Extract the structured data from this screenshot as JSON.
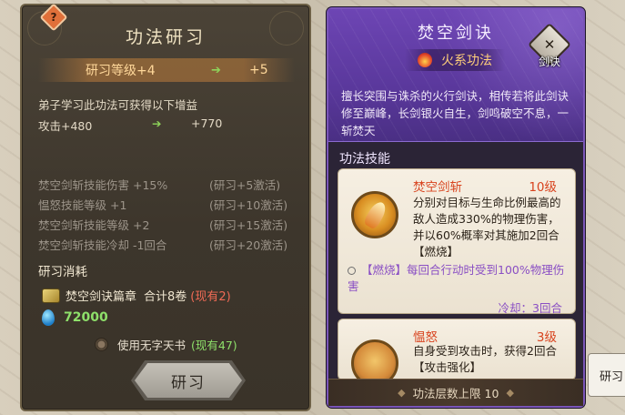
{
  "left_panel": {
    "help_badge": "?",
    "title": "功法研习",
    "level": {
      "label": "研习等级+4",
      "next": "+5"
    },
    "gain_desc": "弟子学习此功法可获得以下增益",
    "attack": {
      "current": "攻击+480",
      "next": "+770"
    },
    "bonuses": [
      {
        "name": "焚空剑斩技能伤害 +15%",
        "req": "(研习+5激活)"
      },
      {
        "name": "愠怒技能等级 +1",
        "req": "(研习+10激活)"
      },
      {
        "name": "焚空剑斩技能等级 +2",
        "req": "(研习+15激活)"
      },
      {
        "name": "焚空剑斩技能冷却 -1回合",
        "req": "(研习+20激活)"
      }
    ],
    "cost_title": "研习消耗",
    "cost_item": {
      "name": "焚空剑诀篇章",
      "total": "合计8卷",
      "owned": "(现有2)"
    },
    "spirit": "72000",
    "tome": {
      "label": "使用无字天书",
      "owned": "(现有47)"
    },
    "study_button": "研习"
  },
  "right_panel": {
    "title": "焚空剑诀",
    "element": "火系功法",
    "weapon_label": "剑诀",
    "description": "擅长突围与诛杀的火行剑诀，相传若将此剑诀修至巅峰，长剑银火自生，剑鸣破空不息，一斩焚天",
    "skills_title": "功法技能",
    "skills": [
      {
        "name": "焚空剑斩",
        "level": "10级",
        "text": "分别对目标与生命比例最高的敌人造成330%的物理伤害，并以60%概率对其施加2回合【燃烧】",
        "burn_note": "【燃烧】每回合行动时受到100%物理伤害",
        "cooldown": "冷却：3回合"
      },
      {
        "name": "愠怒",
        "level": "3级",
        "text": "自身受到攻击时，获得2回合【攻击强化】"
      }
    ],
    "footer": "功法层数上限 10"
  },
  "edge_tab": "研习"
}
